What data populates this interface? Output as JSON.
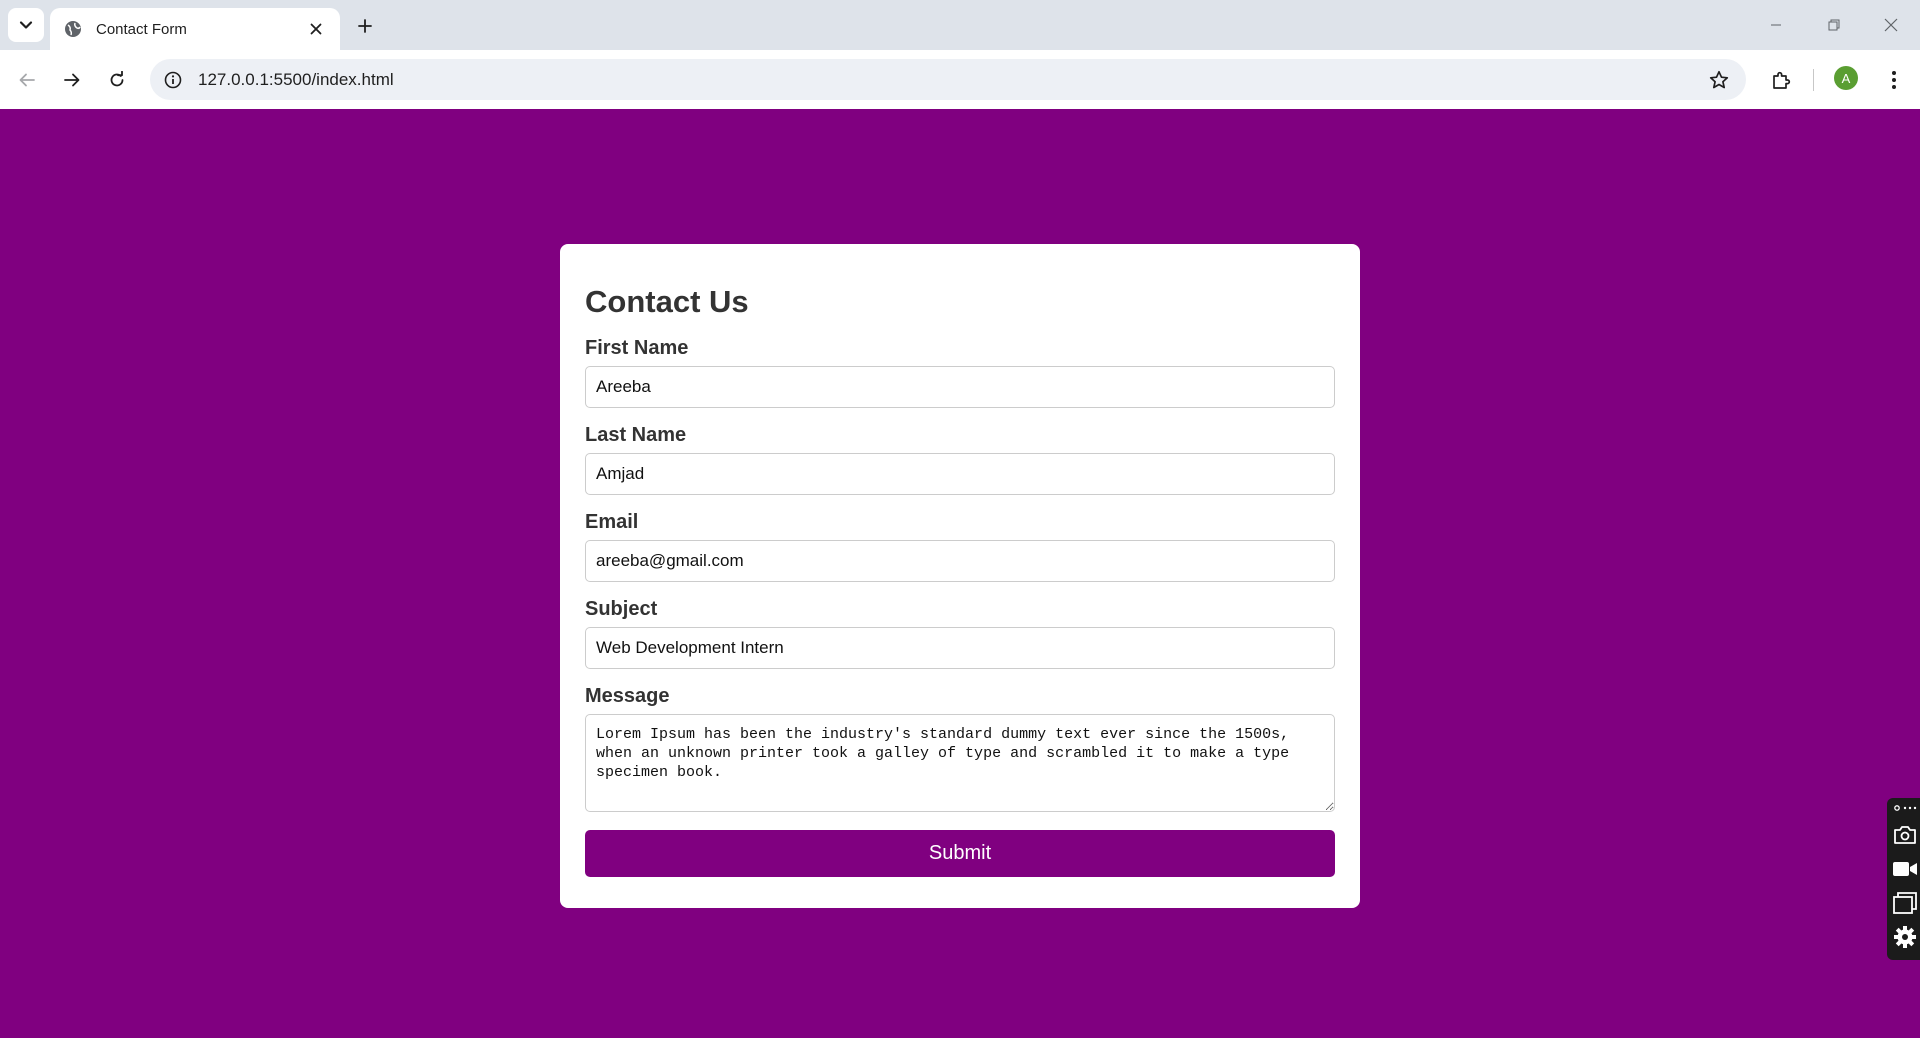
{
  "browser": {
    "tab_title": "Contact Form",
    "url": "127.0.0.1:5500/index.html",
    "avatar_initial": "A"
  },
  "form": {
    "heading": "Contact Us",
    "first_name": {
      "label": "First Name",
      "value": "Areeba"
    },
    "last_name": {
      "label": "Last Name",
      "value": "Amjad"
    },
    "email": {
      "label": "Email",
      "value": "areeba@gmail.com"
    },
    "subject": {
      "label": "Subject",
      "value": "Web Development Intern"
    },
    "message": {
      "label": "Message",
      "value": "Lorem Ipsum has been the industry's standard dummy text ever since the 1500s, when an unknown printer took a galley of type and scrambled it to make a type specimen book."
    },
    "submit_label": "Submit"
  },
  "colors": {
    "page_background": "#800080",
    "card_background": "#ffffff",
    "button_background": "#800080",
    "label_text": "#333333"
  },
  "icons": {
    "tab_search": "chevron-down-icon",
    "tab_favicon": "globe-icon",
    "tab_close": "close-icon",
    "new_tab": "plus-icon",
    "back": "arrow-left-icon",
    "forward": "arrow-right-icon",
    "reload": "reload-icon",
    "site_info": "info-icon",
    "bookmark": "star-icon",
    "extensions": "puzzle-icon",
    "menu": "kebab-menu-icon",
    "side_panel": [
      "camera-icon",
      "video-icon",
      "window-icon",
      "gear-icon"
    ]
  }
}
